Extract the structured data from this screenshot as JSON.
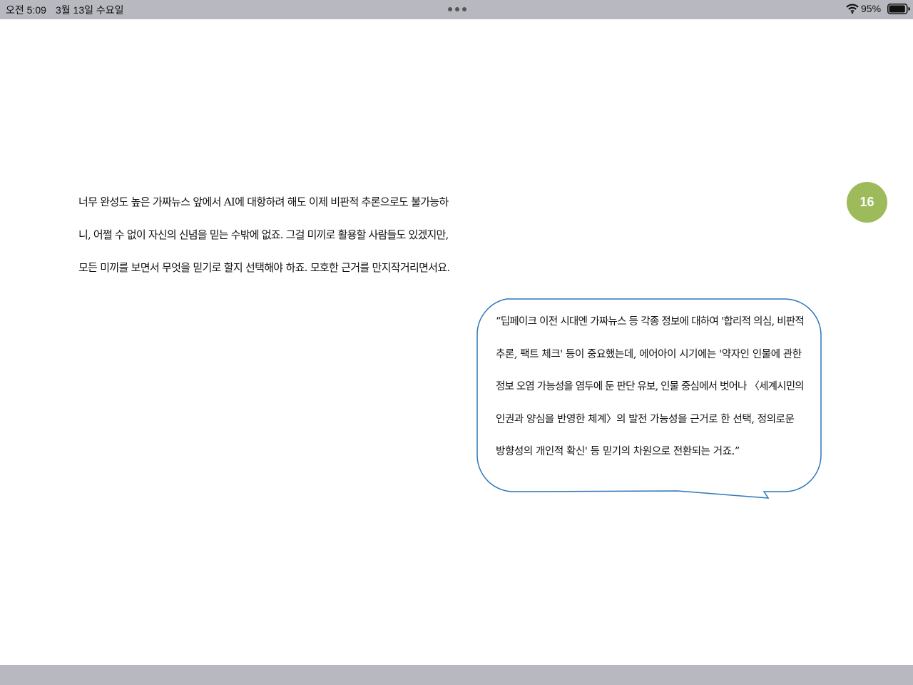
{
  "status_bar": {
    "time": "오전 5:09",
    "date": "3월 13일 수요일",
    "battery_percent": "95%",
    "battery_level": 0.95
  },
  "page_number": "16",
  "body_lines": [
    "너무 완성도 높은 가짜뉴스 앞에서 AI에 대항하려 해도 이제 비판적 추론으로도 불가능하",
    "니, 어쩔 수 없이 자신의 신념을 믿는 수밖에 없죠. 그걸 미끼로 활용할 사람들도 있겠지만,",
    "모든 미끼를 보면서 무엇을 믿기로 할지 선택해야 하죠. 모호한 근거를 만지작거리면서요."
  ],
  "quote_lines": [
    "“딥페이크 이전 시대엔 가짜뉴스 등 각종 정보에 대하여 '합리적 의심, 비판적",
    "추론, 팩트 체크' 등이 중요했는데, 에어아이 시기에는 '약자인 인물에 관한",
    "정보 오염 가능성을 염두에 둔 판단 유보, 인물 중심에서 벗어나 〈세계시민의",
    "인권과 양심을 반영한 체계〉의 발전 가능성을 근거로 한 선택, 정의로운",
    "방향성의 개인적 확신' 등 믿기의 차원으로 전환되는 거죠.”"
  ],
  "colors": {
    "status_bar": "#b8b9c0",
    "badge": "#9dbb5a",
    "bubble_border": "#2e77b8"
  }
}
